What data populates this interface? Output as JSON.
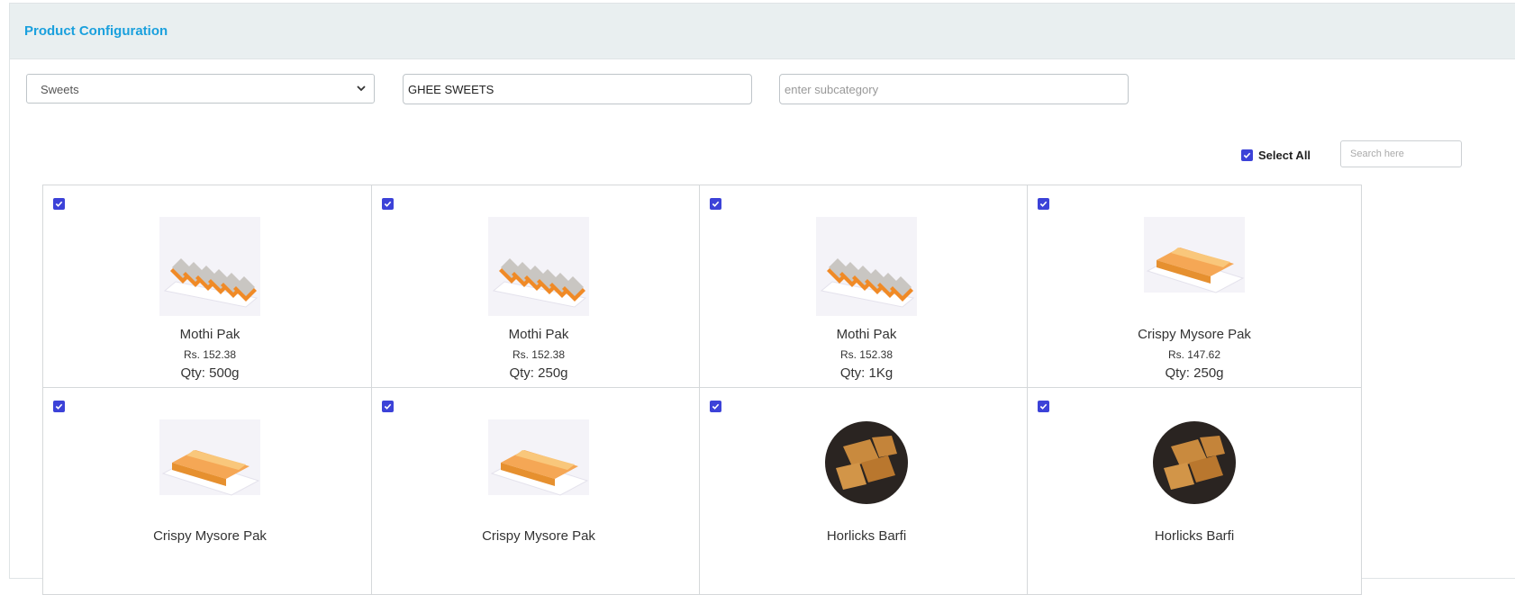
{
  "panel": {
    "title": "Product Configuration"
  },
  "filters": {
    "category_selected": "Sweets",
    "category_icon": "chevron-down-icon",
    "subcategory1_value": "GHEE SWEETS",
    "subcategory2_placeholder": "enter subcategory"
  },
  "toolbar": {
    "select_all_label": "Select All",
    "select_all_checked": true,
    "search_placeholder": "Search here"
  },
  "colors": {
    "accent": "#1aa0dd",
    "checkbox": "#3c42d8",
    "header_bg": "#e9eff0"
  },
  "products": [
    {
      "name": "Mothi Pak",
      "price": "Rs. 152.38",
      "qty": "Qty: 500g",
      "image": "mothi-pak",
      "checked": true
    },
    {
      "name": "Mothi Pak",
      "price": "Rs. 152.38",
      "qty": "Qty: 250g",
      "image": "mothi-pak",
      "checked": true
    },
    {
      "name": "Mothi Pak",
      "price": "Rs. 152.38",
      "qty": "Qty: 1Kg",
      "image": "mothi-pak",
      "checked": true
    },
    {
      "name": "Crispy Mysore Pak",
      "price": "Rs. 147.62",
      "qty": "Qty: 250g",
      "image": "mysore-pak",
      "checked": true
    },
    {
      "name": "Crispy Mysore Pak",
      "price": "",
      "qty": "",
      "image": "mysore-pak",
      "checked": true
    },
    {
      "name": "Crispy Mysore Pak",
      "price": "",
      "qty": "",
      "image": "mysore-pak",
      "checked": true
    },
    {
      "name": "Horlicks Barfi",
      "price": "",
      "qty": "",
      "image": "horlicks-barfi",
      "checked": true
    },
    {
      "name": "Horlicks Barfi",
      "price": "",
      "qty": "",
      "image": "horlicks-barfi",
      "checked": true
    }
  ]
}
